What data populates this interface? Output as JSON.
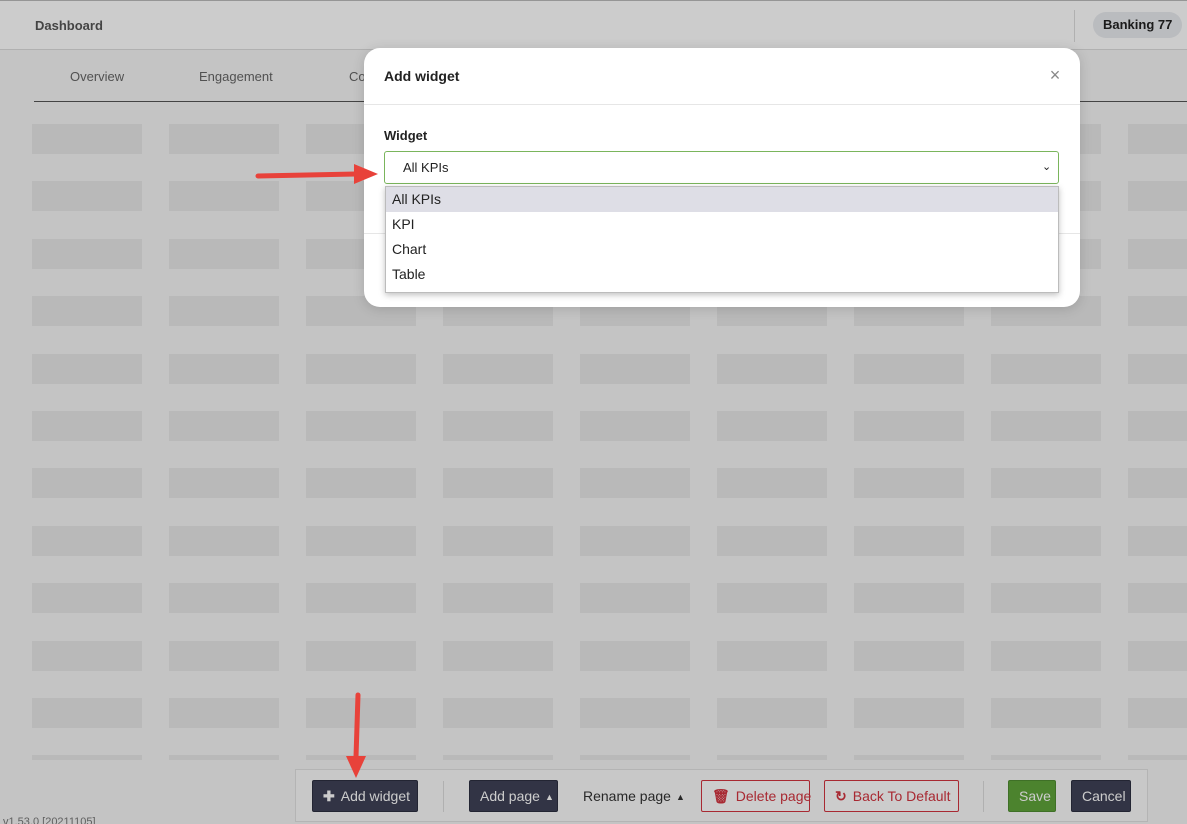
{
  "header": {
    "title": "Dashboard",
    "account_badge": "Banking 77"
  },
  "tabs": [
    {
      "label": "Overview"
    },
    {
      "label": "Engagement"
    },
    {
      "label": "Co"
    }
  ],
  "toolbar": {
    "add_widget": "Add widget",
    "add_page": "Add page",
    "rename_page": "Rename page",
    "delete_page": "Delete page",
    "back_to_default": "Back To Default",
    "save": "Save",
    "cancel": "Cancel",
    "icons": {
      "add": "plus-icon",
      "delete": "trash-icon",
      "reset": "refresh-icon",
      "caret": "caret-up-icon"
    }
  },
  "version": "v1.53.0 [20211105]",
  "modal": {
    "title": "Add widget",
    "close_icon": "close-icon",
    "field_label": "Widget",
    "select_value": "All KPIs",
    "options": [
      {
        "label": "All KPIs"
      },
      {
        "label": "KPI"
      },
      {
        "label": "Chart"
      },
      {
        "label": "Table"
      }
    ],
    "selected_index": 0
  },
  "colors": {
    "accent_dark": "#3f4257",
    "save_green": "#5fa43a",
    "danger_red": "#d3343f",
    "select_border": "#7ab55c",
    "annotation_arrow": "#e8423a"
  }
}
